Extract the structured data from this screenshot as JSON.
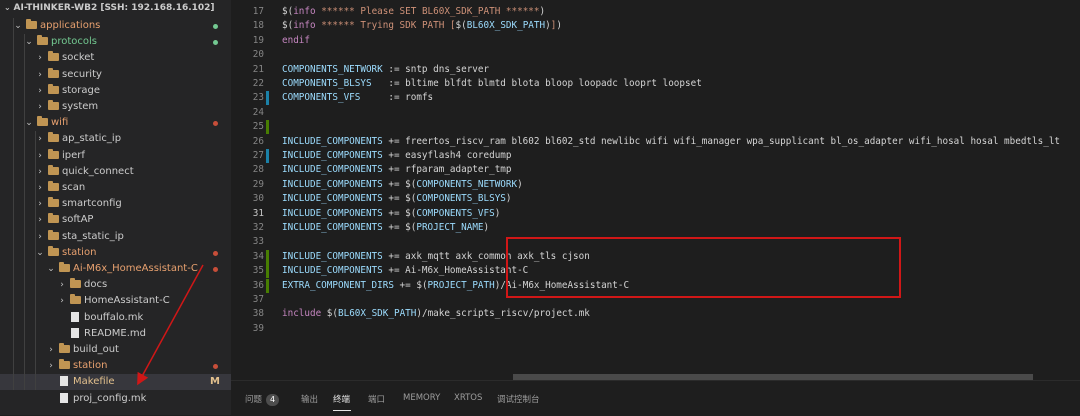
{
  "workspace_title": "AI-THINKER-WB2 [SSH: 192.168.16.102]",
  "colors": {
    "green": "#73c991",
    "red": "#c74e39",
    "modified": "#e2c08d",
    "orange_text": "#e8a16f",
    "annotation": "#d01717"
  },
  "explorer": [
    {
      "label": "applications",
      "chevron": "⌄",
      "icon": "folder",
      "indent": 1,
      "color": "#e8a16f",
      "dot": "#73c991"
    },
    {
      "label": "protocols",
      "chevron": "⌄",
      "icon": "folder",
      "indent": 2,
      "color": "#73c991",
      "dot": "#73c991"
    },
    {
      "label": "socket",
      "chevron": "›",
      "icon": "folder",
      "indent": 3,
      "color": "#cccccc",
      "dot": ""
    },
    {
      "label": "security",
      "chevron": "›",
      "icon": "folder",
      "indent": 3,
      "color": "#cccccc",
      "dot": ""
    },
    {
      "label": "storage",
      "chevron": "›",
      "icon": "folder",
      "indent": 3,
      "color": "#cccccc",
      "dot": ""
    },
    {
      "label": "system",
      "chevron": "›",
      "icon": "folder",
      "indent": 3,
      "color": "#cccccc",
      "dot": ""
    },
    {
      "label": "wifi",
      "chevron": "⌄",
      "icon": "folder",
      "indent": 2,
      "color": "#e8a16f",
      "dot": "#c74e39"
    },
    {
      "label": "ap_static_ip",
      "chevron": "›",
      "icon": "folder",
      "indent": 3,
      "color": "#cccccc",
      "dot": ""
    },
    {
      "label": "iperf",
      "chevron": "›",
      "icon": "folder",
      "indent": 3,
      "color": "#cccccc",
      "dot": ""
    },
    {
      "label": "quick_connect",
      "chevron": "›",
      "icon": "folder",
      "indent": 3,
      "color": "#cccccc",
      "dot": ""
    },
    {
      "label": "scan",
      "chevron": "›",
      "icon": "folder",
      "indent": 3,
      "color": "#cccccc",
      "dot": ""
    },
    {
      "label": "smartconfig",
      "chevron": "›",
      "icon": "folder",
      "indent": 3,
      "color": "#cccccc",
      "dot": ""
    },
    {
      "label": "softAP",
      "chevron": "›",
      "icon": "folder",
      "indent": 3,
      "color": "#cccccc",
      "dot": ""
    },
    {
      "label": "sta_static_ip",
      "chevron": "›",
      "icon": "folder",
      "indent": 3,
      "color": "#cccccc",
      "dot": ""
    },
    {
      "label": "station",
      "chevron": "⌄",
      "icon": "folder",
      "indent": 3,
      "color": "#e8a16f",
      "dot": "#c74e39"
    },
    {
      "label": "Ai-M6x_HomeAssistant-C",
      "chevron": "⌄",
      "icon": "folder",
      "indent": 4,
      "color": "#e8a16f",
      "dot": "#c74e39"
    },
    {
      "label": "docs",
      "chevron": "›",
      "icon": "folder",
      "indent": 5,
      "color": "#cccccc",
      "dot": ""
    },
    {
      "label": "HomeAssistant-C",
      "chevron": "›",
      "icon": "folder",
      "indent": 5,
      "color": "#cccccc",
      "dot": ""
    },
    {
      "label": "bouffalo.mk",
      "chevron": "",
      "icon": "file",
      "indent": 5,
      "color": "#cccccc",
      "dot": ""
    },
    {
      "label": "README.md",
      "chevron": "",
      "icon": "file",
      "indent": 5,
      "color": "#cccccc",
      "dot": ""
    },
    {
      "label": "build_out",
      "chevron": "›",
      "icon": "folder",
      "indent": 4,
      "color": "#cccccc",
      "dot": ""
    },
    {
      "label": "station",
      "chevron": "›",
      "icon": "folder",
      "indent": 4,
      "color": "#e8a16f",
      "dot": "#c74e39"
    },
    {
      "label": "Makefile",
      "chevron": "",
      "icon": "file",
      "indent": 4,
      "color": "#e2c08d",
      "dot": "",
      "flag": "M",
      "selected": true
    },
    {
      "label": "proj_config.mk",
      "chevron": "",
      "icon": "file",
      "indent": 4,
      "color": "#cccccc",
      "dot": ""
    }
  ],
  "code_lines": [
    {
      "n": "17",
      "mark": "",
      "html": "<span class='dollar'>$(</span><span class='kw'>info</span><span class='str'> ****** Please SET BL60X_SDK_PATH ******</span><span class='dollar'>)</span>"
    },
    {
      "n": "18",
      "mark": "",
      "html": "<span class='dollar'>$(</span><span class='kw'>info</span><span class='str'> ****** Trying SDK PATH [</span><span class='dollar'>$(</span><span class='var'>BL60X_SDK_PATH</span><span class='dollar'>)</span><span class='str'>]</span><span class='dollar'>)</span>"
    },
    {
      "n": "19",
      "mark": "",
      "html": "<span class='kw'>endif</span>"
    },
    {
      "n": "20",
      "mark": "",
      "html": ""
    },
    {
      "n": "21",
      "mark": "",
      "html": "<span class='var'>COMPONENTS_NETWORK</span> := sntp dns_server"
    },
    {
      "n": "22",
      "mark": "",
      "html": "<span class='var'>COMPONENTS_BLSYS</span>   := bltime blfdt blmtd blota bloop loopadc looprt loopset"
    },
    {
      "n": "23",
      "mark": "#1b81a8",
      "html": "<span class='var'>COMPONENTS_VFS</span>     := romfs"
    },
    {
      "n": "24",
      "mark": "",
      "html": ""
    },
    {
      "n": "25",
      "mark": "#487e02",
      "html": ""
    },
    {
      "n": "26",
      "mark": "",
      "html": "<span class='var'>INCLUDE_COMPONENTS</span> += freertos_riscv_ram bl602 bl602_std newlibc wifi wifi_manager wpa_supplicant bl_os_adapter wifi_hosal hosal mbedtls_lt"
    },
    {
      "n": "27",
      "mark": "#1b81a8",
      "html": "<span class='var'>INCLUDE_COMPONENTS</span> += easyflash4 coredump"
    },
    {
      "n": "28",
      "mark": "",
      "html": "<span class='var'>INCLUDE_COMPONENTS</span> += rfparam_adapter_tmp"
    },
    {
      "n": "29",
      "mark": "",
      "html": "<span class='var'>INCLUDE_COMPONENTS</span> += <span class='dollar'>$(</span><span class='var'>COMPONENTS_NETWORK</span><span class='dollar'>)</span>"
    },
    {
      "n": "30",
      "mark": "",
      "html": "<span class='var'>INCLUDE_COMPONENTS</span> += <span class='dollar'>$(</span><span class='var'>COMPONENTS_BLSYS</span><span class='dollar'>)</span>"
    },
    {
      "n": "31",
      "mark": "",
      "cur": true,
      "html": "<span class='var'>INCLUDE_COMPONENTS</span> += <span class='dollar'>$(</span><span class='var'>COMPONENTS_VFS</span><span class='dollar'>)</span>"
    },
    {
      "n": "32",
      "mark": "",
      "html": "<span class='var'>INCLUDE_COMPONENTS</span> += <span class='dollar'>$(</span><span class='var'>PROJECT_NAME</span><span class='dollar'>)</span>"
    },
    {
      "n": "33",
      "mark": "",
      "html": ""
    },
    {
      "n": "34",
      "mark": "#487e02",
      "html": "<span class='var'>INCLUDE_COMPONENTS</span> += axk_mqtt axk_common axk_tls cjson"
    },
    {
      "n": "35",
      "mark": "#487e02",
      "html": "<span class='var'>INCLUDE_COMPONENTS</span> += Ai-M6x_HomeAssistant-C"
    },
    {
      "n": "36",
      "mark": "#487e02",
      "html": "<span class='var'>EXTRA_COMPONENT_DIRS</span> += <span class='dollar'>$(</span><span class='var'>PROJECT_PATH</span><span class='dollar'>)</span>/Ai-M6x_HomeAssistant-C"
    },
    {
      "n": "37",
      "mark": "",
      "html": ""
    },
    {
      "n": "38",
      "mark": "",
      "html": "<span class='kw'>include</span> <span class='dollar'>$(</span><span class='var'>BL60X_SDK_PATH</span><span class='dollar'>)</span>/make_scripts_riscv/project.mk"
    },
    {
      "n": "39",
      "mark": "",
      "html": ""
    }
  ],
  "panel": {
    "problems": "问题",
    "problems_count": "4",
    "output": "输出",
    "terminal": "终端",
    "ports": "端口",
    "memory": "MEMORY",
    "xrtos": "XRTOS",
    "debug_console": "调试控制台"
  }
}
